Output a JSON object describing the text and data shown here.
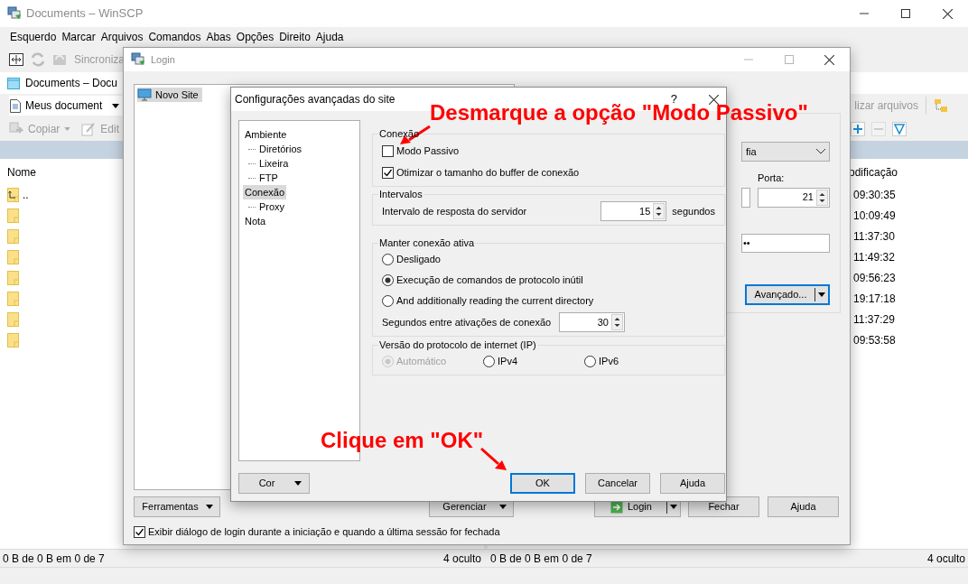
{
  "window": {
    "title": "Documents – WinSCP"
  },
  "menu": [
    "Esquerdo",
    "Marcar",
    "Arquivos",
    "Comandos",
    "Abas",
    "Opções",
    "Direito",
    "Ajuda"
  ],
  "toolbar": {
    "sync_label": "Sincroniza"
  },
  "session_tab": {
    "label": "Documents – Docu"
  },
  "left_panel": {
    "path": "Meus document",
    "toolbar": [
      {
        "kind": "copy",
        "label": "Copiar"
      },
      {
        "kind": "edit",
        "label": "Edit"
      }
    ],
    "column": "Nome",
    "rows": [
      {
        "kind": "parent",
        "name": ".."
      },
      {
        "kind": "folder"
      },
      {
        "kind": "folder"
      },
      {
        "kind": "folder"
      },
      {
        "kind": "folder"
      },
      {
        "kind": "folder"
      },
      {
        "kind": "folder"
      },
      {
        "kind": "folder"
      }
    ],
    "status": "0 B de 0 B em 0 de 7",
    "hidden_count": "4 oculto"
  },
  "right_panel": {
    "toolbar_label": "lizar arquivos",
    "column": "odificação",
    "rows": [
      {
        "modified": "09:30:35"
      },
      {
        "modified": "10:09:49"
      },
      {
        "modified": "11:37:30"
      },
      {
        "modified": "11:49:32"
      },
      {
        "modified": "09:56:23"
      },
      {
        "modified": "19:17:18"
      },
      {
        "modified": "11:37:29"
      },
      {
        "modified": "09:53:58"
      }
    ],
    "status": "0 B de 0 B em 0 de 7",
    "hidden_count": "4 oculto"
  },
  "login_dialog": {
    "title": "Login",
    "sites": [
      {
        "label": "Novo Site",
        "selected": true
      }
    ],
    "protocol": "fia",
    "port_label": "Porta:",
    "port": "21",
    "password": "••",
    "advanced_button": "Avançado...",
    "buttons": [
      {
        "label": "Ferramentas",
        "kind": "menu"
      },
      {
        "label": "Gerenciar",
        "kind": "menu"
      },
      {
        "label": "Login",
        "kind": "split"
      },
      {
        "label": "Fechar",
        "kind": "plain"
      },
      {
        "label": "Ajuda",
        "kind": "plain"
      }
    ],
    "show_on_startup": {
      "label": "Exibir diálogo de login durante a iniciação e quando a última sessão for fechada",
      "checked": true
    }
  },
  "advanced_dialog": {
    "title": "Configurações avançadas do site",
    "help": "?",
    "tree": [
      {
        "label": "Ambiente",
        "selected": false,
        "children": [
          {
            "label": "Diretórios",
            "selected": false
          },
          {
            "label": "Lixeira",
            "selected": false
          },
          {
            "label": "FTP",
            "selected": false
          }
        ]
      },
      {
        "label": "Conexão",
        "selected": true,
        "children": [
          {
            "label": "Proxy",
            "selected": false
          }
        ]
      },
      {
        "label": "Nota",
        "selected": false
      }
    ],
    "groups": [
      {
        "title": "Conexão",
        "kind": "stack",
        "items": [
          {
            "kind": "checkbox",
            "label": "Modo Passivo",
            "checked": false
          },
          {
            "kind": "checkbox",
            "label": "Otimizar o tamanho do buffer de conexão",
            "checked": true
          }
        ]
      },
      {
        "title": "Intervalos",
        "kind": "stack",
        "items": [
          {
            "kind": "spin",
            "label": "Intervalo de resposta do servidor",
            "value": "15",
            "unit": "segundos"
          }
        ]
      },
      {
        "title": "Manter conexão ativa",
        "kind": "stack",
        "items": [
          {
            "kind": "radio",
            "label": "Desligado",
            "selected": false,
            "disabled": false
          },
          {
            "kind": "radio",
            "label": "Execução de comandos de protocolo inútil",
            "selected": true,
            "disabled": false
          },
          {
            "kind": "radio",
            "label": "And additionally reading the current directory",
            "selected": false,
            "disabled": false
          },
          {
            "kind": "spin",
            "label": "Segundos entre ativações de conexão",
            "value": "30"
          }
        ]
      },
      {
        "title": "Versão do protocolo de internet (IP)",
        "kind": "row",
        "items": [
          {
            "kind": "radio",
            "label": "Automático",
            "selected": true,
            "disabled": true
          },
          {
            "kind": "radio",
            "label": "IPv4",
            "selected": false,
            "disabled": false
          },
          {
            "kind": "radio",
            "label": "IPv6",
            "selected": false,
            "disabled": false
          }
        ]
      }
    ],
    "buttons": [
      {
        "label": "Cor",
        "kind": "menu"
      },
      {
        "label": "OK",
        "kind": "default"
      },
      {
        "label": "Cancelar",
        "kind": "plain"
      },
      {
        "label": "Ajuda",
        "kind": "plain"
      }
    ]
  },
  "annotations": [
    {
      "text": "Desmarque a opção \"Modo Passivo\""
    },
    {
      "text": "Clique em \"OK\""
    }
  ]
}
